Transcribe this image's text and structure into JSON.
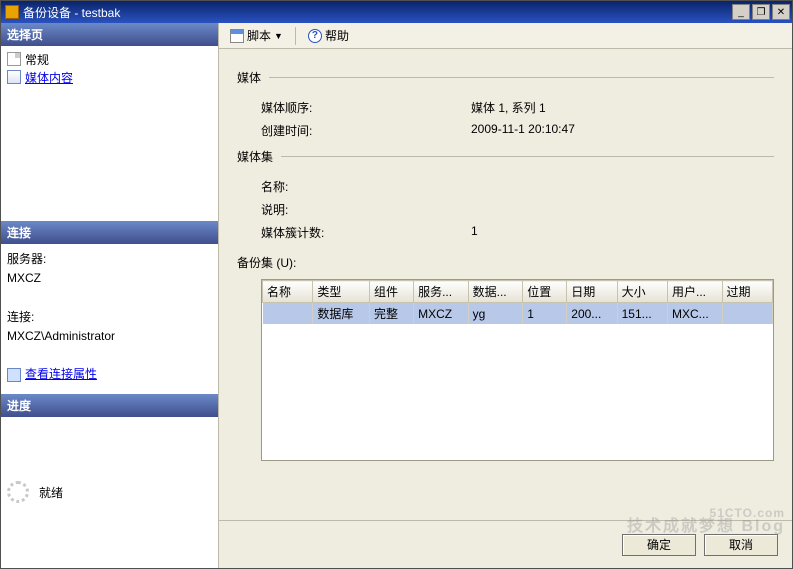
{
  "title": "备份设备 - testbak",
  "sidebar": {
    "select_header": "选择页",
    "nav_general": "常规",
    "nav_media": "媒体内容",
    "conn_header": "连接",
    "server_label": "服务器:",
    "server_value": "MXCZ",
    "conn_label": "连接:",
    "conn_value": "MXCZ\\Administrator",
    "viewprops": "查看连接属性",
    "prog_header": "进度",
    "prog_value": "就绪"
  },
  "toolbar": {
    "script": "脚本",
    "help": "帮助"
  },
  "groups": {
    "media": "媒体",
    "mediaSet": "媒体集",
    "backupSet": "备份集 (U):",
    "media_seq_k": "媒体顺序:",
    "media_seq_v": "媒体 1, 系列 1",
    "created_k": "创建时间:",
    "created_v": "2009-11-1 20:10:47",
    "name_k": "名称:",
    "name_v": "",
    "desc_k": "说明:",
    "desc_v": "",
    "fam_k": "媒体簇计数:",
    "fam_v": "1"
  },
  "columns": [
    "名称",
    "类型",
    "组件",
    "服务...",
    "数据...",
    "位置",
    "日期",
    "大小",
    "用户...",
    "过期"
  ],
  "row": [
    "",
    "数据库",
    "完整",
    "MXCZ",
    "yg",
    "1",
    "200...",
    "151...",
    "MXC...",
    ""
  ],
  "buttons": {
    "ok": "确定",
    "cancel": "取消"
  },
  "watermark": {
    "l1": "51CTO.com",
    "l2": "技术成就梦想 Blog"
  }
}
